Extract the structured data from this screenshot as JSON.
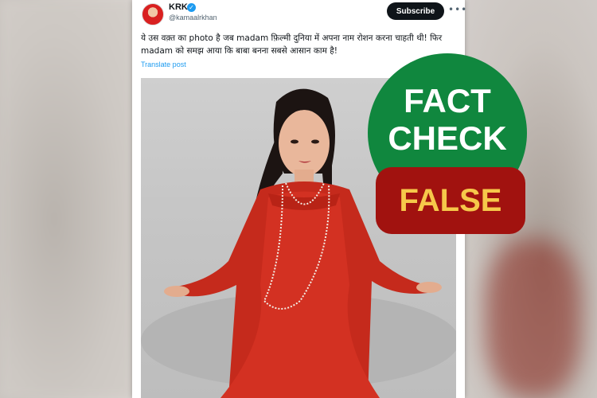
{
  "post": {
    "author_name": "KRK",
    "handle": "@kamaalrkhan",
    "subscribe_label": "Subscribe",
    "more_label": "•••",
    "verified_glyph": "✓",
    "text": "ये उस वक़्त का photo है जब madam फ़िल्मी दुनिया में अपना नाम रोशन करना चाहती थी! फिर madam को समझ आया कि बाबा बनना सबसे आसान काम है!",
    "translate_label": "Translate post"
  },
  "badge": {
    "line1": "FACT",
    "line2": "CHECK",
    "verdict": "FALSE",
    "colors": {
      "circle": "#10873e",
      "verdict_bg": "#a1120f",
      "verdict_text": "#f6c84a"
    }
  },
  "icons": {
    "avatar": "avatar-icon",
    "verified": "verified-badge-icon",
    "more": "more-options-icon"
  }
}
